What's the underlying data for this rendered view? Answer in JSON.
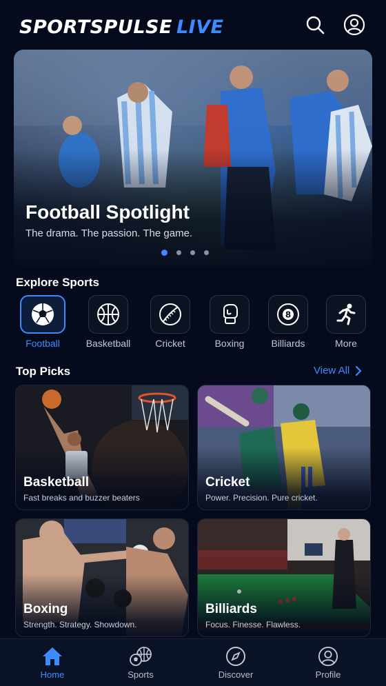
{
  "header": {
    "brand": "SPORTSPULSE",
    "brand_suffix": "LIVE",
    "search_icon": "search-icon",
    "profile_icon": "user-circle-icon"
  },
  "hero": {
    "title": "Football Spotlight",
    "subtitle": "The drama. The passion. The game.",
    "slide_count": 4,
    "active_slide": 1
  },
  "explore": {
    "title": "Explore Sports",
    "items": [
      {
        "label": "Football",
        "icon": "soccer-ball-icon",
        "active": true
      },
      {
        "label": "Basketball",
        "icon": "basketball-icon",
        "active": false
      },
      {
        "label": "Cricket",
        "icon": "cricket-ball-icon",
        "active": false
      },
      {
        "label": "Boxing",
        "icon": "boxing-glove-icon",
        "active": false
      },
      {
        "label": "Billiards",
        "icon": "eight-ball-icon",
        "active": false
      },
      {
        "label": "More",
        "icon": "running-person-icon",
        "active": false
      }
    ]
  },
  "top_picks": {
    "title": "Top Picks",
    "view_all": "View All",
    "cards": [
      {
        "title": "Basketball",
        "subtitle": "Fast breaks and buzzer beaters"
      },
      {
        "title": "Cricket",
        "subtitle": "Power. Precision. Pure cricket."
      },
      {
        "title": "Boxing",
        "subtitle": "Strength. Strategy. Showdown."
      },
      {
        "title": "Billiards",
        "subtitle": "Focus. Finesse. Flawless."
      }
    ]
  },
  "bottom_nav": {
    "items": [
      {
        "label": "Home",
        "icon": "home-icon",
        "active": true
      },
      {
        "label": "Sports",
        "icon": "sports-balls-icon",
        "active": false
      },
      {
        "label": "Discover",
        "icon": "compass-icon",
        "active": false
      },
      {
        "label": "Profile",
        "icon": "user-circle-icon",
        "active": false
      }
    ]
  },
  "colors": {
    "background": "#050b1c",
    "accent": "#3d8bff",
    "text": "#ffffff",
    "muted": "#c2c7d2"
  }
}
